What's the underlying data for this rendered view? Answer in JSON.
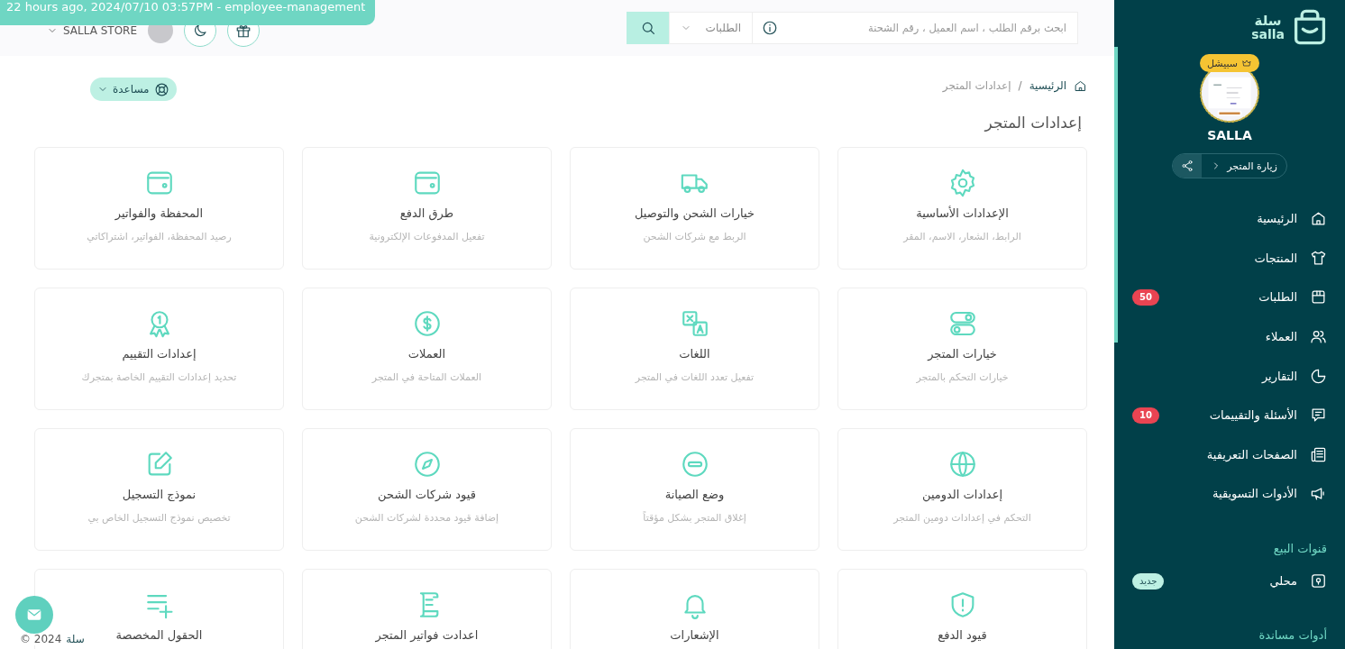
{
  "overlay_tag": "22 hours ago, 2024/07/10 03:57PM - employee-management",
  "header": {
    "store_menu": "SALLA STORE",
    "search_scope": "الطلبات",
    "search": {
      "placeholder": "ابحث برقم الطلب ، اسم العميل ، رقم الشحنة"
    }
  },
  "breadcrumb_separator": "/",
  "breadcrumb": [
    {
      "label": "الرئيسية",
      "selected": false
    },
    {
      "label": "إعدادات المتجر",
      "selected": true
    }
  ],
  "help_button": "مساعدة",
  "page_title": "إعدادات المتجر",
  "cards": [
    {
      "title": "الإعدادات الأساسية",
      "subtitle": "الرابط، الشعار، الاسم، المقر"
    },
    {
      "title": "خيارات الشحن والتوصيل",
      "subtitle": "الربط مع شركات الشحن"
    },
    {
      "title": "طرق الدفع",
      "subtitle": "تفعيل المدفوعات الإلكترونية"
    },
    {
      "title": "المحفظة والفواتير",
      "subtitle": "رصيد المحفظة، الفواتير، اشتراكاتي"
    },
    {
      "title": "خيارات المتجر",
      "subtitle": "خيارات التحكم بالمتجر"
    },
    {
      "title": "اللغات",
      "subtitle": "تفعيل تعدد اللغات في المتجر"
    },
    {
      "title": "العملات",
      "subtitle": "العملات المتاحة في المتجر"
    },
    {
      "title": "إعدادات التقييم",
      "subtitle": "تحديد إعدادات التقييم الخاصة بمتجرك"
    },
    {
      "title": "إعدادات الدومين",
      "subtitle": "التحكم في إعدادات دومين المتجر"
    },
    {
      "title": "وضع الصيانة",
      "subtitle": "إغلاق المتجر بشكل مؤقتاً"
    },
    {
      "title": "قيود شركات الشحن",
      "subtitle": "إضافة قيود محددة لشركات الشحن"
    },
    {
      "title": "نموذج التسجيل",
      "subtitle": "تخصيص نموذج التسجيل الخاص بي"
    },
    {
      "title": "قيود الدفع"
    },
    {
      "title": "الإشعارات"
    },
    {
      "title": "اعدادت فواتير المتجر"
    },
    {
      "title": "الحقول المخصصة"
    }
  ],
  "footer": {
    "brand": "سلة",
    "copyright": "© 2024"
  },
  "sidebar": {
    "logo": {
      "arabic": "سلة",
      "latin": "salla"
    },
    "plan_badge": "سبيشل",
    "store_name": "SALLA",
    "visit_button": "زيارة المتجر",
    "nav": [
      {
        "label": "الرئيسية"
      },
      {
        "label": "المنتجات"
      },
      {
        "label": "الطلبات",
        "badge": {
          "text": "50",
          "kind": "count"
        }
      },
      {
        "label": "العملاء"
      },
      {
        "label": "التقارير"
      },
      {
        "label": "الأسئلة والتقييمات",
        "badge": {
          "text": "10",
          "kind": "count"
        }
      },
      {
        "label": "الصفحات التعريفية"
      },
      {
        "label": "الأدوات التسويقية"
      }
    ],
    "sections": [
      {
        "heading": "قنوات البيع",
        "items": [
          {
            "label": "محلي",
            "badge": {
              "text": "جديد",
              "kind": "new"
            }
          }
        ]
      },
      {
        "heading": "أدوات مساندة"
      }
    ]
  }
}
